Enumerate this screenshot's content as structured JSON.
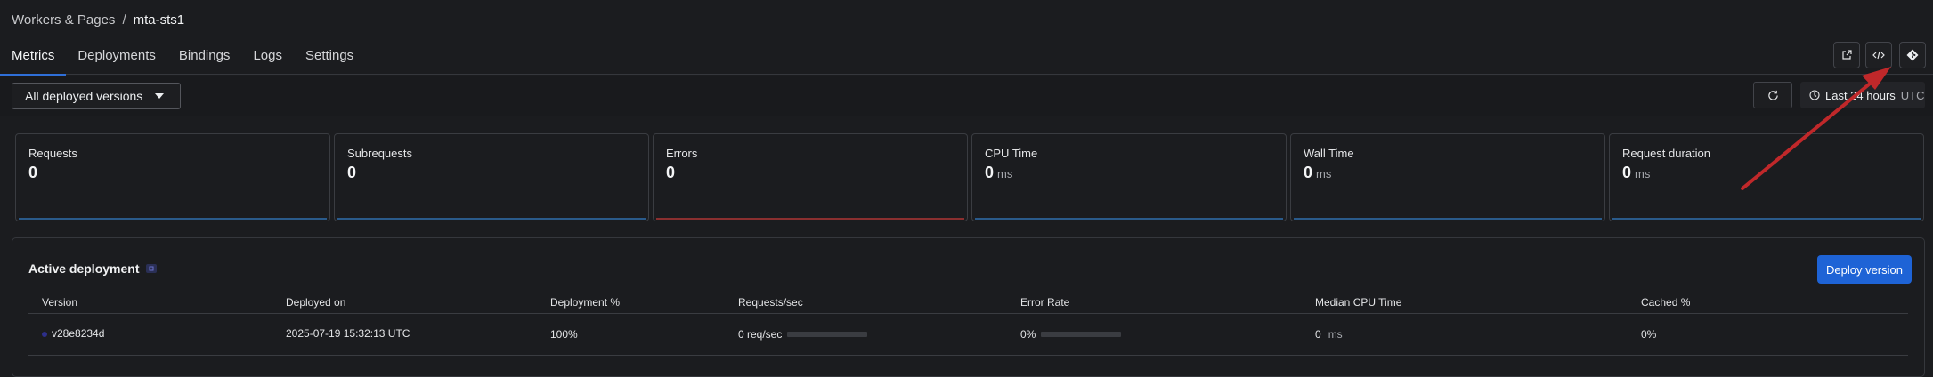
{
  "breadcrumb": {
    "parent": "Workers & Pages",
    "separator": "/",
    "current": "mta-sts1"
  },
  "tabs": [
    {
      "label": "Metrics",
      "active": true
    },
    {
      "label": "Deployments"
    },
    {
      "label": "Bindings"
    },
    {
      "label": "Logs"
    },
    {
      "label": "Settings"
    }
  ],
  "header_icons": [
    "external-link-icon",
    "code-icon",
    "git-icon"
  ],
  "toolbar": {
    "version_select": "All deployed versions",
    "time_range": "Last 24 hours",
    "timezone": "UTC"
  },
  "metrics": [
    {
      "label": "Requests",
      "value": "0",
      "unit": ""
    },
    {
      "label": "Subrequests",
      "value": "0",
      "unit": ""
    },
    {
      "label": "Errors",
      "value": "0",
      "unit": ""
    },
    {
      "label": "CPU Time",
      "value": "0",
      "unit": "ms"
    },
    {
      "label": "Wall Time",
      "value": "0",
      "unit": "ms"
    },
    {
      "label": "Request duration",
      "value": "0",
      "unit": "ms"
    }
  ],
  "active_deployment": {
    "title": "Active deployment",
    "deploy_button": "Deploy version",
    "columns": [
      "Version",
      "Deployed on",
      "Deployment %",
      "Requests/sec",
      "Error Rate",
      "Median CPU Time",
      "Cached %"
    ],
    "row": {
      "version": "v28e8234d",
      "deployed_on": "2025-07-19 15:32:13",
      "deployed_tz": "UTC",
      "deployment_pct": "100%",
      "requests_sec": "0 req/sec",
      "error_rate": "0%",
      "median_cpu_value": "0",
      "median_cpu_unit": "ms",
      "cached_pct": "0%"
    }
  },
  "colors": {
    "background": "#1b1c1f",
    "accent": "#1e63d6",
    "annotation_arrow": "#c0282a"
  }
}
